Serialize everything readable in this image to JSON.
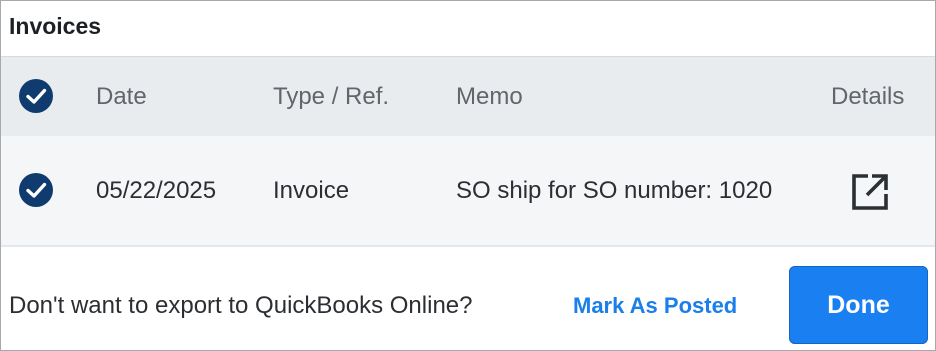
{
  "panel": {
    "title": "Invoices"
  },
  "table": {
    "select_all_checked": true,
    "columns": {
      "date": "Date",
      "type_ref": "Type / Ref.",
      "memo": "Memo",
      "details": "Details"
    },
    "rows": [
      {
        "checked": true,
        "date": "05/22/2025",
        "type_ref": "Invoice",
        "memo": "SO ship for SO number: 1020",
        "details_icon": "external-link-icon"
      }
    ]
  },
  "footer": {
    "prompt": "Don't want to export to QuickBooks Online?",
    "mark_as_posted": "Mark As Posted",
    "done": "Done"
  },
  "colors": {
    "check_fill": "#0f3b6e",
    "link": "#1a7fe8",
    "primary_button": "#1a7ff0",
    "header_bg": "#e9ecef",
    "row_bg": "#f5f6f8"
  }
}
